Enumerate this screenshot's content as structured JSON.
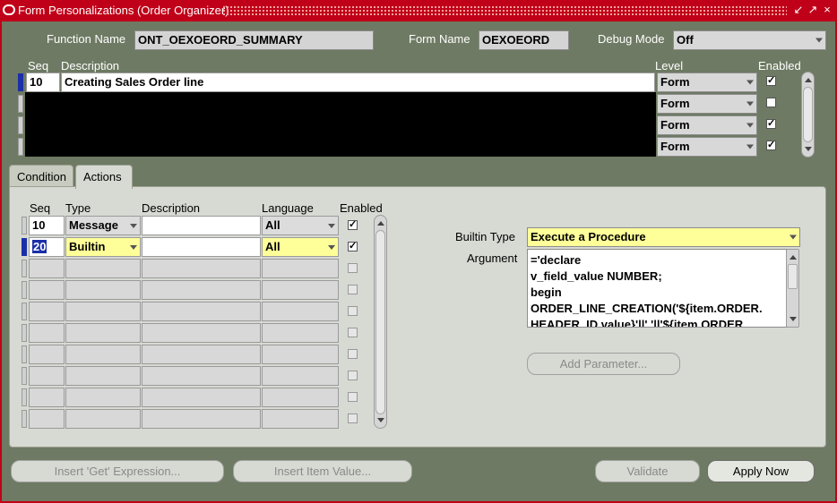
{
  "window": {
    "title": "Form Personalizations (Order Organizer)",
    "controls": [
      "↙",
      "↗",
      "×"
    ]
  },
  "header": {
    "function_name_label": "Function Name",
    "function_name_value": "ONT_OEXOEORD_SUMMARY",
    "form_name_label": "Form Name",
    "form_name_value": "OEXOEORD",
    "debug_mode_label": "Debug Mode",
    "debug_mode_value": "Off"
  },
  "rules": {
    "columns": {
      "seq": "Seq",
      "description": "Description",
      "level": "Level",
      "enabled": "Enabled"
    },
    "rows": [
      {
        "seq": "10",
        "description": "Creating Sales Order line",
        "level": "Form",
        "enabled": true
      },
      {
        "seq": "",
        "description": "",
        "level": "Form",
        "enabled": false
      },
      {
        "seq": "",
        "description": "",
        "level": "Form",
        "enabled": true
      },
      {
        "seq": "",
        "description": "",
        "level": "Form",
        "enabled": true
      }
    ]
  },
  "tabs": [
    {
      "label": "Condition",
      "active": false
    },
    {
      "label": "Actions",
      "active": true
    }
  ],
  "actions": {
    "columns": {
      "seq": "Seq",
      "type": "Type",
      "description": "Description",
      "language": "Language",
      "enabled": "Enabled"
    },
    "rows": [
      {
        "seq": "10",
        "type": "Message",
        "description": "",
        "language": "All",
        "enabled": true
      },
      {
        "seq": "20",
        "type": "Builtin",
        "description": "",
        "language": "All",
        "enabled": true
      },
      {
        "seq": "",
        "type": "",
        "description": "",
        "language": "",
        "enabled": false
      },
      {
        "seq": "",
        "type": "",
        "description": "",
        "language": "",
        "enabled": false
      },
      {
        "seq": "",
        "type": "",
        "description": "",
        "language": "",
        "enabled": false
      },
      {
        "seq": "",
        "type": "",
        "description": "",
        "language": "",
        "enabled": false
      },
      {
        "seq": "",
        "type": "",
        "description": "",
        "language": "",
        "enabled": false
      },
      {
        "seq": "",
        "type": "",
        "description": "",
        "language": "",
        "enabled": false
      },
      {
        "seq": "",
        "type": "",
        "description": "",
        "language": "",
        "enabled": false
      },
      {
        "seq": "",
        "type": "",
        "description": "",
        "language": "",
        "enabled": false
      }
    ]
  },
  "builtin": {
    "type_label": "Builtin Type",
    "type_value": "Execute a Procedure",
    "argument_label": "Argument",
    "argument_lines": [
      "='declare",
      "v_field_value NUMBER;",
      "begin",
      "ORDER_LINE_CREATION('${item.ORDER.",
      "HEADER_ID.value}'||','||'${item.ORDER."
    ],
    "add_parameter_label": "Add Parameter..."
  },
  "footer": {
    "insert_get_label": "Insert 'Get' Expression...",
    "insert_item_label": "Insert Item Value...",
    "validate_label": "Validate",
    "apply_now_label": "Apply Now"
  },
  "colors": {
    "title_bar": "#c00018",
    "background": "#6e7a63",
    "highlight": "#ffff99",
    "current_row": "#1b2fa8"
  }
}
